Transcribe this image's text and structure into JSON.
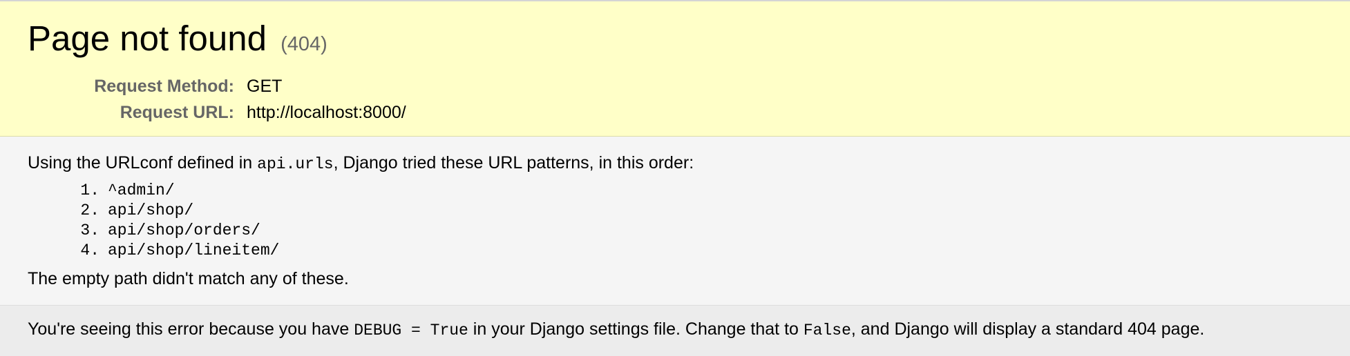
{
  "summary": {
    "title": "Page not found",
    "status_code": "(404)",
    "meta": [
      {
        "label": "Request Method:",
        "value": "GET"
      },
      {
        "label": "Request URL:",
        "value": "http://localhost:8000/"
      }
    ]
  },
  "info": {
    "urlconf_prefix": "Using the URLconf defined in ",
    "urlconf_module": "api.urls",
    "urlconf_suffix": ", Django tried these URL patterns, in this order:",
    "patterns": [
      {
        "num": "1.",
        "pattern": "^admin/"
      },
      {
        "num": "2.",
        "pattern": "api/shop/"
      },
      {
        "num": "3.",
        "pattern": "api/shop/orders/"
      },
      {
        "num": "4.",
        "pattern": "api/shop/lineitem/"
      }
    ],
    "no_match": "The empty path didn't match any of these."
  },
  "explanation": {
    "part1": "You're seeing this error because you have ",
    "code1": "DEBUG = True",
    "part2": " in your Django settings file. Change that to ",
    "code2": "False",
    "part3": ", and Django will display a standard 404 page."
  },
  "colors": {
    "summary_background": "#ffffc8",
    "info_background": "#f5f5f5",
    "explanation_background": "#ececec",
    "label_text": "#666666"
  }
}
